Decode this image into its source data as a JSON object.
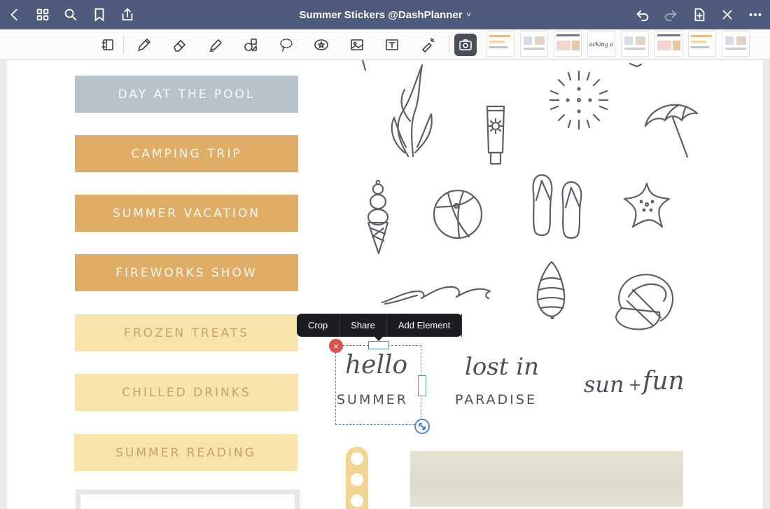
{
  "header": {
    "title": "Summer Stickers @DashPlanner",
    "title_chevron": "˅",
    "icons": [
      "back-icon",
      "grid-icon",
      "search-icon",
      "bookmark-icon",
      "share-icon",
      "undo-icon",
      "redo-icon",
      "add-page-icon",
      "close-icon",
      "more-icon"
    ]
  },
  "toolbar": {
    "tools": [
      "notebook-icon",
      "pen-icon",
      "eraser-icon",
      "highlighter-icon",
      "shapes-icon",
      "lasso-icon",
      "sticker-icon",
      "image-icon",
      "text-icon",
      "laser-pointer-icon",
      "camera-icon"
    ],
    "active_tool": "camera-icon"
  },
  "labels": [
    {
      "text": "DAY AT THE POOL",
      "style": "blue",
      "color": "#b8c2cb"
    },
    {
      "text": "CAMPING TRIP",
      "style": "orange",
      "color": "#e0ad67"
    },
    {
      "text": "SUMMER VACATION",
      "style": "orange",
      "color": "#e0ad67"
    },
    {
      "text": "FIREWORKS SHOW",
      "style": "orange",
      "color": "#e0ad67"
    },
    {
      "text": "FROZEN TREATS",
      "style": "yellow",
      "color": "#f8e4aa"
    },
    {
      "text": "CHILLED DRINKS",
      "style": "yellow",
      "color": "#f8e4aa"
    },
    {
      "text": "SUMMER READING",
      "style": "yellow",
      "color": "#f8e4aa"
    }
  ],
  "stickers": {
    "hello_summer": {
      "script": "hello",
      "caps": "SUMMER"
    },
    "lost_in_paradise": {
      "script": "lost in",
      "caps": "PARADISE"
    },
    "sun_fun": {
      "left": "sun",
      "plus": "+",
      "right": "fun"
    }
  },
  "context_menu": {
    "crop": "Crop",
    "share": "Share",
    "add_element": "Add Element"
  },
  "selection": {
    "delete_symbol": "×"
  },
  "thumbnail_text": "ocking o"
}
